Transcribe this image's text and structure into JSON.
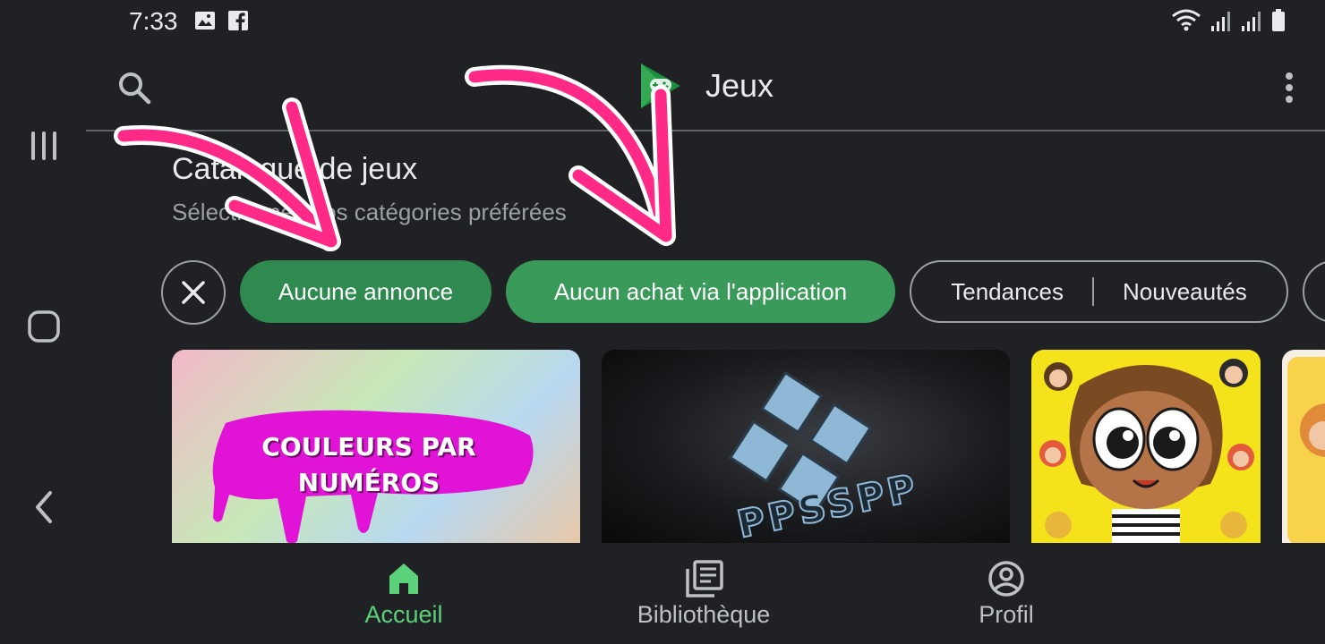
{
  "status_bar": {
    "time": "7:33"
  },
  "app_bar": {
    "title": "Jeux"
  },
  "section": {
    "title": "Catalogue de jeux",
    "subtitle": "Sélectionnez vos catégories préférées"
  },
  "chips": [
    {
      "label": "Aucune annonce",
      "selected": true
    },
    {
      "label": "Aucun achat via l'application",
      "selected": true
    },
    {
      "label": "Tendances"
    },
    {
      "label": "Nouveautés"
    }
  ],
  "cards": [
    {
      "title_line1": "COULEURS PAR",
      "title_line2": "NUMÉROS"
    },
    {
      "title": "PPSSPP"
    }
  ],
  "bottom_nav": [
    {
      "label": "Accueil",
      "active": true
    },
    {
      "label": "Bibliothèque"
    },
    {
      "label": "Profil"
    }
  ],
  "colors": {
    "accent": "#5bd17a",
    "annotation": "#ff2a88",
    "background": "#202124"
  }
}
